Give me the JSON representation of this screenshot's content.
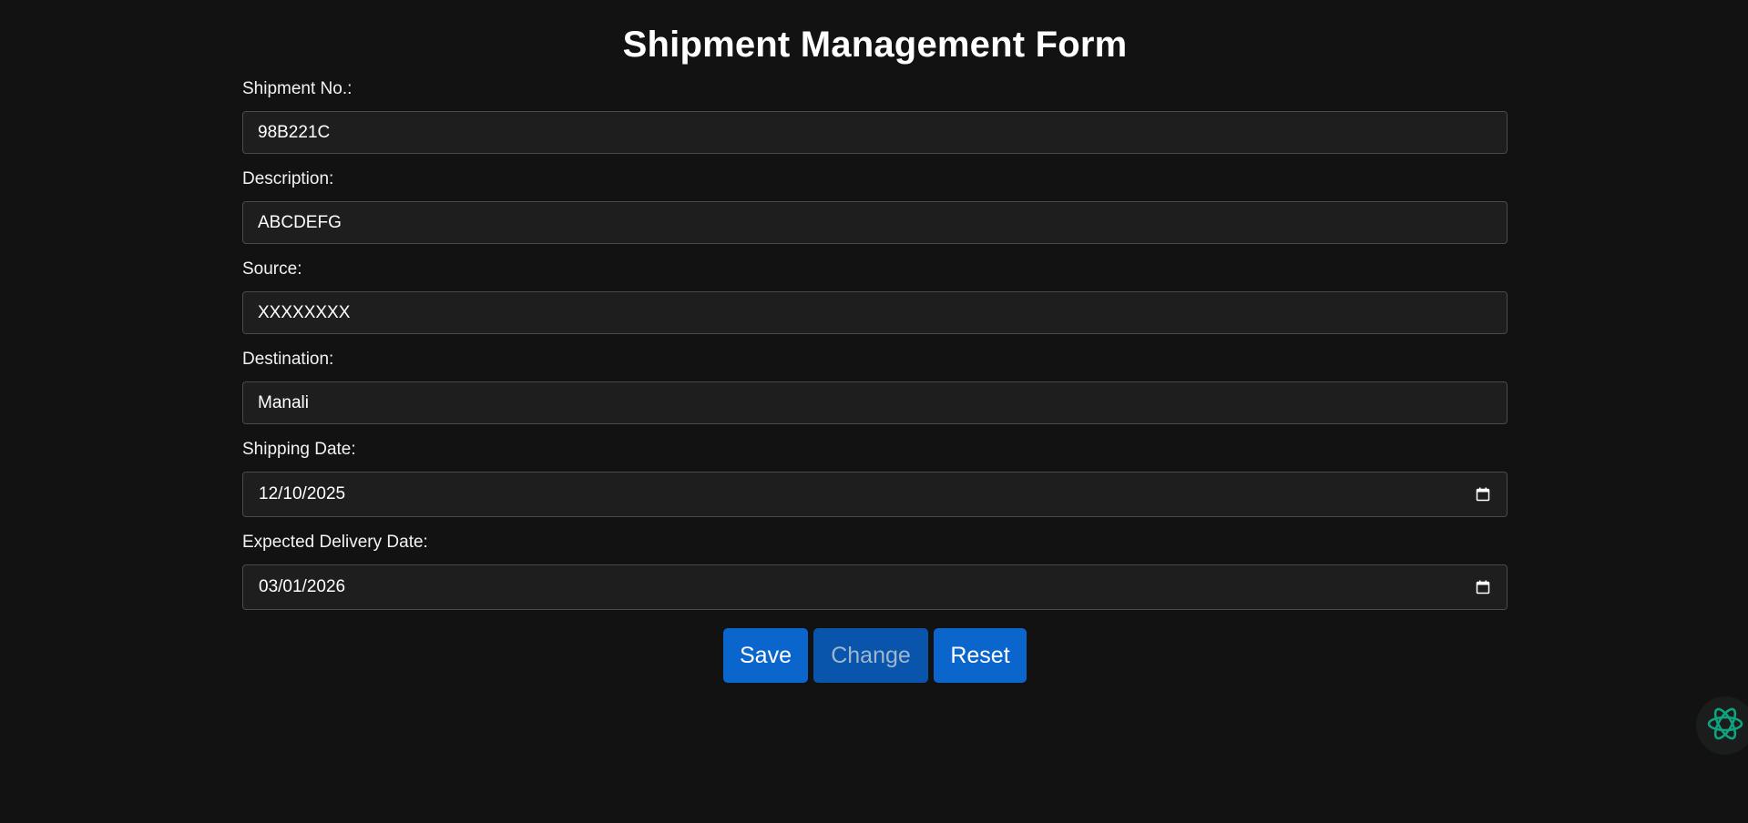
{
  "form": {
    "title": "Shipment Management Form",
    "fields": [
      {
        "label": "Shipment No.:",
        "value": "98B221C"
      },
      {
        "label": "Description:",
        "value": "ABCDEFG"
      },
      {
        "label": "Source:",
        "value": "XXXXXXXX"
      },
      {
        "label": "Destination:",
        "value": "Manali"
      },
      {
        "label": "Shipping Date:",
        "value": "12/10/2025"
      },
      {
        "label": "Expected Delivery Date:",
        "value": "03/01/2026"
      }
    ],
    "buttons": {
      "save": "Save",
      "change": "Change",
      "reset": "Reset"
    }
  },
  "icons": {
    "calendar": "calendar-icon",
    "assistant": "atom-icon"
  },
  "colors": {
    "background": "#121212",
    "input_bg": "#1e1e1e",
    "button": "#0a66cc",
    "button_disabled": "#0955ab",
    "assistant_accent": "#10a37f"
  }
}
